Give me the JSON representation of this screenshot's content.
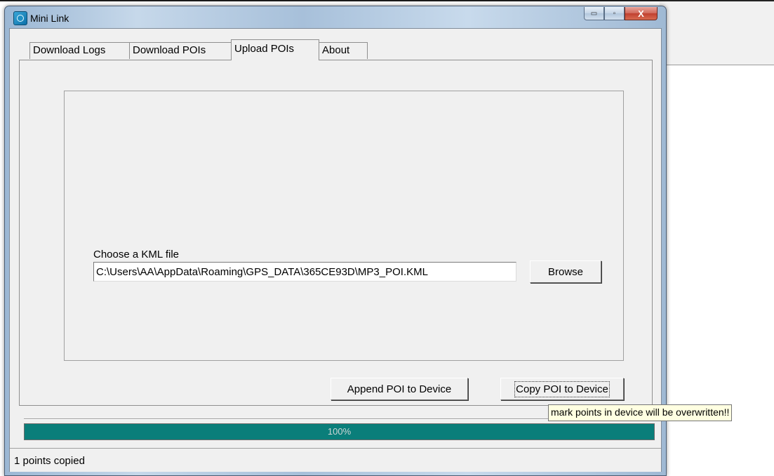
{
  "window": {
    "title": "Mini Link",
    "minimize_glyph": "▭",
    "maximize_glyph": "▫",
    "close_glyph": "X"
  },
  "tabs": [
    {
      "label": "Download Logs"
    },
    {
      "label": "Download POIs"
    },
    {
      "label": "Upload POIs",
      "active": true
    },
    {
      "label": "About"
    }
  ],
  "upload": {
    "file_label": "Choose a KML file",
    "file_path": "C:\\Users\\AA\\AppData\\Roaming\\GPS_DATA\\365CE93D\\MP3_POI.KML",
    "browse_label": "Browse",
    "append_label": "Append POI to Device",
    "copy_label": "Copy POI to Device"
  },
  "progress": {
    "value": 1.0,
    "text": "100%",
    "color": "#0a7e7a"
  },
  "status": {
    "text": "1 points copied"
  },
  "tooltip": {
    "text": "mark points in device will be overwritten!!"
  }
}
